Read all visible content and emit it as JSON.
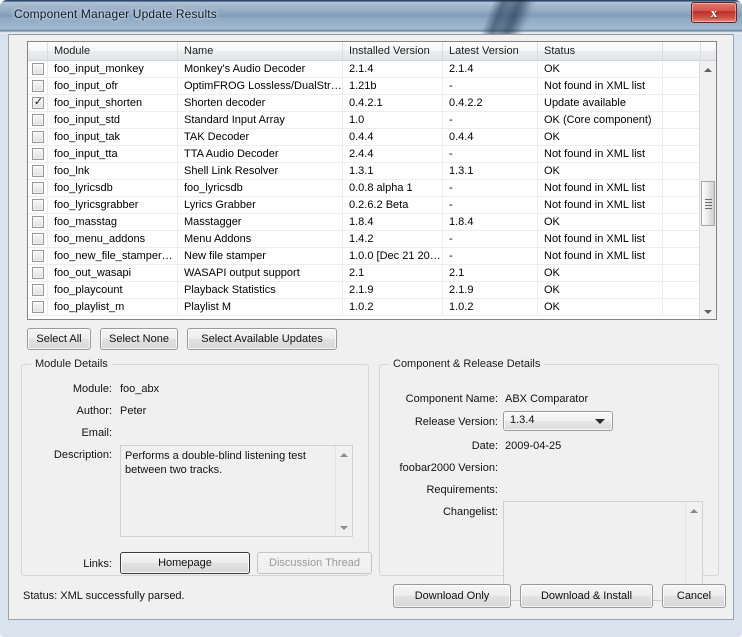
{
  "window": {
    "title": "Component Manager Update Results",
    "close_label": "x"
  },
  "table": {
    "columns": [
      "",
      "Module",
      "Name",
      "Installed Version",
      "Latest Version",
      "Status",
      ""
    ],
    "rows": [
      {
        "checked": false,
        "module": "foo_input_monkey",
        "name": "Monkey's Audio Decoder",
        "installed": "2.1.4",
        "latest": "2.1.4",
        "status": "OK"
      },
      {
        "checked": false,
        "module": "foo_input_ofr",
        "name": "OptimFROG Lossless/DualStr…",
        "installed": "1.21b",
        "latest": "-",
        "status": "Not found in XML list"
      },
      {
        "checked": true,
        "module": "foo_input_shorten",
        "name": "Shorten decoder",
        "installed": "0.4.2.1",
        "latest": "0.4.2.2",
        "status": "Update available"
      },
      {
        "checked": false,
        "module": "foo_input_std",
        "name": "Standard Input Array",
        "installed": "1.0",
        "latest": "-",
        "status": "OK (Core component)"
      },
      {
        "checked": false,
        "module": "foo_input_tak",
        "name": "TAK Decoder",
        "installed": "0.4.4",
        "latest": "0.4.4",
        "status": "OK"
      },
      {
        "checked": false,
        "module": "foo_input_tta",
        "name": "TTA Audio Decoder",
        "installed": "2.4.4",
        "latest": "-",
        "status": "Not found in XML list"
      },
      {
        "checked": false,
        "module": "foo_lnk",
        "name": "Shell Link Resolver",
        "installed": "1.3.1",
        "latest": "1.3.1",
        "status": "OK"
      },
      {
        "checked": false,
        "module": "foo_lyricsdb",
        "name": "foo_lyricsdb",
        "installed": "0.0.8 alpha 1",
        "latest": "-",
        "status": "Not found in XML list"
      },
      {
        "checked": false,
        "module": "foo_lyricsgrabber",
        "name": "Lyrics Grabber",
        "installed": "0.2.6.2 Beta",
        "latest": "-",
        "status": "Not found in XML list"
      },
      {
        "checked": false,
        "module": "foo_masstag",
        "name": "Masstagger",
        "installed": "1.8.4",
        "latest": "1.8.4",
        "status": "OK"
      },
      {
        "checked": false,
        "module": "foo_menu_addons",
        "name": "Menu Addons",
        "installed": "1.4.2",
        "latest": "-",
        "status": "Not found in XML list"
      },
      {
        "checked": false,
        "module": "foo_new_file_stamper…",
        "name": "New file stamper",
        "installed": "1.0.0 [Dec 21 20…",
        "latest": "-",
        "status": "Not found in XML list"
      },
      {
        "checked": false,
        "module": "foo_out_wasapi",
        "name": "WASAPI output support",
        "installed": "2.1",
        "latest": "2.1",
        "status": "OK"
      },
      {
        "checked": false,
        "module": "foo_playcount",
        "name": "Playback Statistics",
        "installed": "2.1.9",
        "latest": "2.1.9",
        "status": "OK"
      },
      {
        "checked": false,
        "module": "foo_playlist_m",
        "name": "Playlist M",
        "installed": "1.0.2",
        "latest": "1.0.2",
        "status": "OK"
      }
    ]
  },
  "select_buttons": {
    "select_all": "Select All",
    "select_none": "Select None",
    "select_available_updates": "Select Available Updates"
  },
  "module_details": {
    "title": "Module Details",
    "module_label": "Module:",
    "module_value": "foo_abx",
    "author_label": "Author:",
    "author_value": "Peter",
    "email_label": "Email:",
    "email_value": "",
    "description_label": "Description:",
    "description_value": "Performs a double-blind listening test\nbetween two tracks.",
    "links_label": "Links:",
    "homepage_button": "Homepage",
    "discussion_button": "Discussion Thread"
  },
  "component_details": {
    "title": "Component & Release Details",
    "component_name_label": "Component Name:",
    "component_name_value": "ABX Comparator",
    "release_version_label": "Release Version:",
    "release_version_value": "1.3.4",
    "date_label": "Date:",
    "date_value": "2009-04-25",
    "foobar_version_label": "foobar2000 Version:",
    "foobar_version_value": "",
    "requirements_label": "Requirements:",
    "requirements_value": "",
    "changelist_label": "Changelist:",
    "changelist_value": ""
  },
  "status_bar": {
    "text": "Status: XML successfully parsed."
  },
  "bottom_buttons": {
    "download_only": "Download Only",
    "download_install": "Download & Install",
    "cancel": "Cancel"
  }
}
